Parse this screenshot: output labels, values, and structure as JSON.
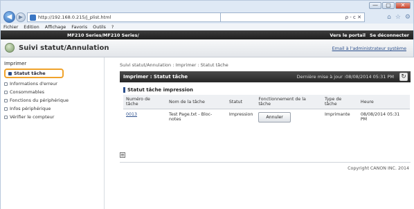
{
  "window": {
    "controls": {
      "minimize": "—",
      "maximize": "▢",
      "close": "✕"
    }
  },
  "navigation": {
    "address_url": "http://192.168.0.215/j_plist.html",
    "address_right": "ρ - c ✕",
    "tab_icons": [
      "⌂",
      "☆",
      "⚙"
    ]
  },
  "menu": [
    "Fichier",
    "Edition",
    "Affichage",
    "Favoris",
    "Outils",
    "?"
  ],
  "printer_bar": {
    "printer_name": "MF210 Series/MF210 Series/",
    "links": [
      "Vers le portail",
      "Se déconnecter"
    ]
  },
  "page_header": {
    "title": "Suivi statut/Annulation",
    "email_link": "Email à l'administrateur système"
  },
  "sidebar": {
    "section": "Imprimer",
    "items": [
      {
        "label": "Statut tâche",
        "active": true
      },
      {
        "label": "Informations d'erreur"
      },
      {
        "label": "Consommables"
      },
      {
        "label": "Fonctions du périphérique"
      },
      {
        "label": "Infos périphérique"
      },
      {
        "label": "Vérifier le compteur"
      }
    ]
  },
  "main": {
    "breadcrumb": "Suivi statut/Annulation : Imprimer : Statut tâche",
    "title": "Imprimer : Statut tâche",
    "last_update": "Dernière mise à jour :08/08/2014 05:31 PM",
    "refresh_icon": "↻",
    "section_title": "Statut tâche impression",
    "table": {
      "headers": [
        "Numéro de tâche",
        "Nom de la tâche",
        "Statut",
        "Fonctionnement de la tâche",
        "Type de tâche",
        "Heure"
      ],
      "rows": [
        {
          "job_number": "0013",
          "job_name": "Test Page.txt - Bloc-notes",
          "status": "Impression",
          "action": "Annuler",
          "type": "Imprimante",
          "time": "08/08/2014 05:31 PM"
        }
      ]
    },
    "expand_icon": "≡",
    "copyright": "Copyright CANON INC. 2014"
  }
}
